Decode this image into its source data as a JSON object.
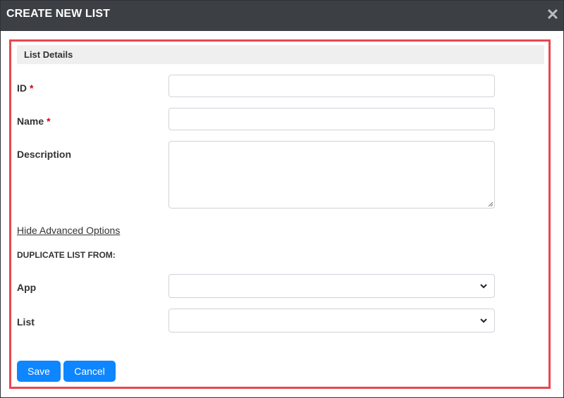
{
  "dialog": {
    "title": "CREATE NEW LIST",
    "close_icon": "close-icon"
  },
  "section": {
    "title": "List Details"
  },
  "form": {
    "id_label": "ID",
    "id_required": "*",
    "id_value": "",
    "name_label": "Name",
    "name_required": "*",
    "name_value": "",
    "description_label": "Description",
    "description_value": ""
  },
  "advanced": {
    "toggle_label": "Hide Advanced Options",
    "duplicate_heading": "DUPLICATE LIST FROM:",
    "app_label": "App",
    "app_selected": "",
    "list_label": "List",
    "list_selected": ""
  },
  "buttons": {
    "save": "Save",
    "cancel": "Cancel"
  },
  "colors": {
    "titlebar": "#3c4045",
    "highlight_border": "#e8474f",
    "primary": "#0d86ff",
    "required": "#d0021b"
  }
}
